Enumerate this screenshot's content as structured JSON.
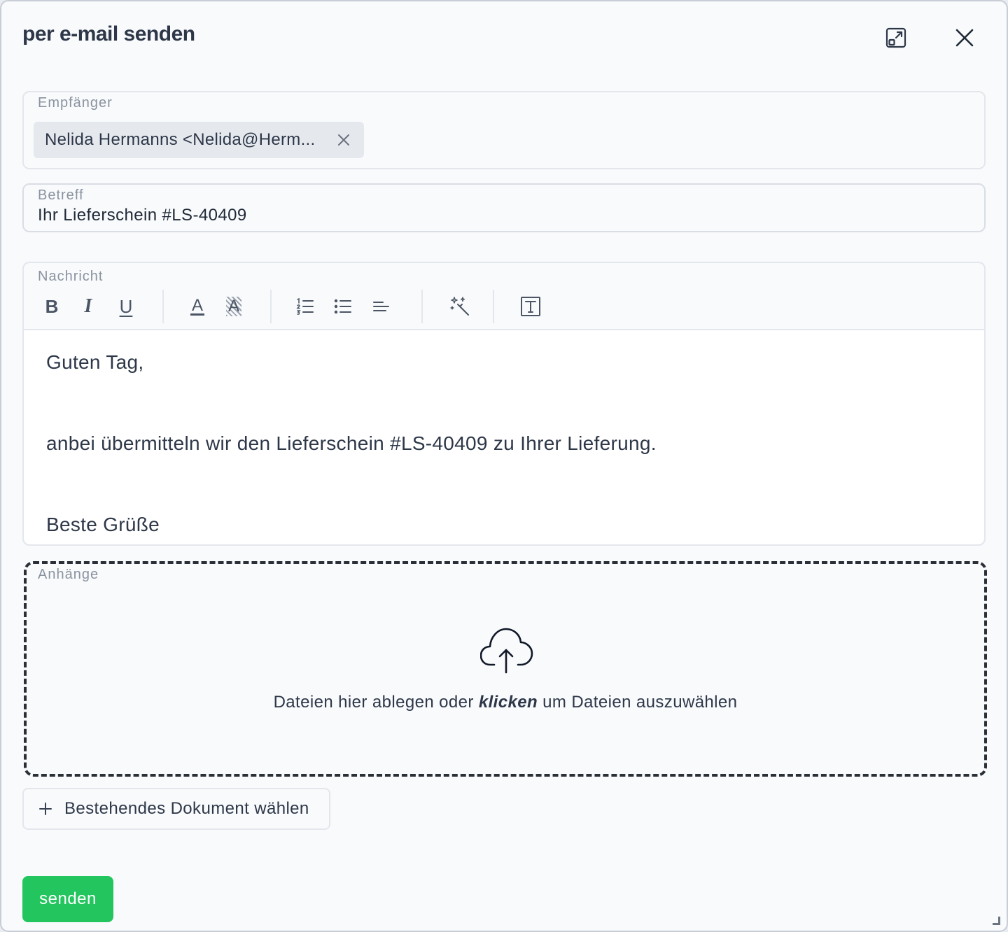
{
  "dialog": {
    "title": "per e-mail senden",
    "expand_icon": "expand-window-icon",
    "close_icon": "close-icon"
  },
  "recipient": {
    "label": "Empfänger",
    "chips": [
      {
        "text": "Nelida Hermanns <Nelida@Herm...",
        "remove_icon": "x-icon"
      }
    ]
  },
  "subject": {
    "label": "Betreff",
    "value": "Ihr Lieferschein #LS-40409"
  },
  "message": {
    "label": "Nachricht",
    "toolbar": {
      "bold": "B",
      "italic": "I",
      "underline": "U",
      "text_color": "A",
      "highlight": "A"
    },
    "lines": [
      "Guten Tag,",
      "anbei übermitteln wir den Lieferschein #LS-40409 zu Ihrer Lieferung.",
      "Beste Grüße"
    ]
  },
  "attachments": {
    "label": "Anhänge",
    "drop_text_before": "Dateien hier ablegen oder ",
    "drop_text_emph": "klicken",
    "drop_text_after": " um Dateien auszuwählen",
    "icon": "cloud-upload-icon"
  },
  "choose_document": {
    "label": "Bestehendes Dokument wählen",
    "icon": "plus-icon"
  },
  "send": {
    "label": "senden"
  },
  "colors": {
    "send_green": "#22c55e",
    "background": "#f8fafc",
    "border": "#e3e7ec"
  }
}
